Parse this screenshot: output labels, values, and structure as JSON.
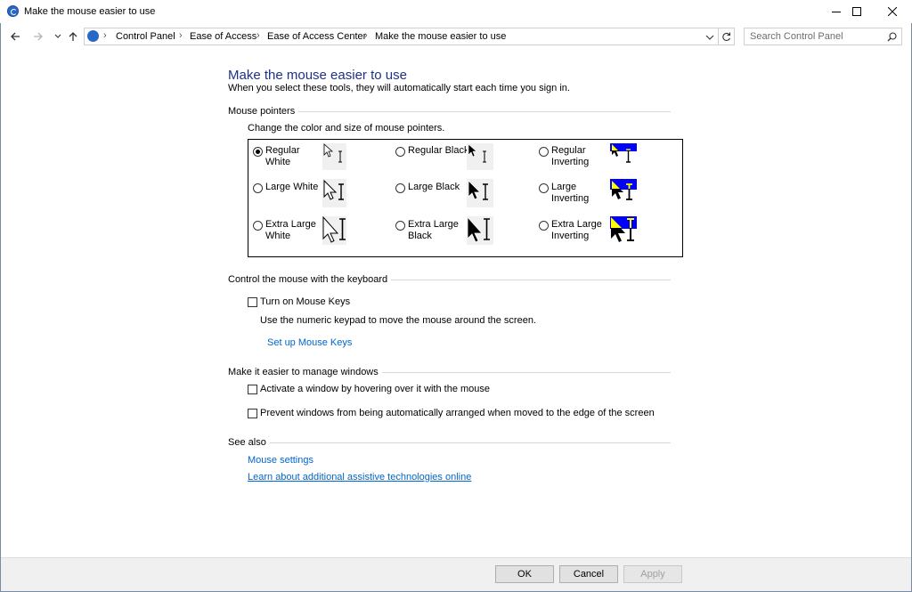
{
  "window": {
    "title": "Make the mouse easier to use"
  },
  "address": {
    "breadcrumbs": [
      "Control Panel",
      "Ease of Access",
      "Ease of Access Center",
      "Make the mouse easier to use"
    ]
  },
  "search": {
    "placeholder": "Search Control Panel"
  },
  "page": {
    "title": "Make the mouse easier to use",
    "subtitle": "When you select these tools, they will automatically start each time you sign in."
  },
  "pointers": {
    "heading": "Mouse pointers",
    "description": "Change the color and size of mouse pointers.",
    "options": [
      {
        "line1": "Regular",
        "line2": "White",
        "checked": true
      },
      {
        "line1": "Regular Black",
        "line2": "",
        "checked": false
      },
      {
        "line1": "Regular",
        "line2": "Inverting",
        "checked": false
      },
      {
        "line1": "Large White",
        "line2": "",
        "checked": false
      },
      {
        "line1": "Large Black",
        "line2": "",
        "checked": false
      },
      {
        "line1": "Large",
        "line2": "Inverting",
        "checked": false
      },
      {
        "line1": "Extra Large",
        "line2": "White",
        "checked": false
      },
      {
        "line1": "Extra Large",
        "line2": "Black",
        "checked": false
      },
      {
        "line1": "Extra Large",
        "line2": "Inverting",
        "checked": false
      }
    ]
  },
  "keyboard": {
    "heading": "Control the mouse with the keyboard",
    "mouse_keys_label": "Turn on Mouse Keys",
    "mouse_keys_description": "Use the numeric keypad to move the mouse around the screen.",
    "setup_link": "Set up Mouse Keys"
  },
  "windows": {
    "heading": "Make it easier to manage windows",
    "hover_label": "Activate a window by hovering over it with the mouse",
    "snap_label": "Prevent windows from being automatically arranged when moved to the edge of the screen"
  },
  "see_also": {
    "heading": "See also",
    "mouse_settings_link": "Mouse settings",
    "assistive_link": "Learn about additional assistive technologies online"
  },
  "footer": {
    "ok": "OK",
    "cancel": "Cancel",
    "apply": "Apply"
  },
  "colors": {
    "title_blue": "#1e3287",
    "link_blue": "#0066cc",
    "inverting_blue": "#0000ff",
    "inverting_yellow": "#ffff00"
  }
}
